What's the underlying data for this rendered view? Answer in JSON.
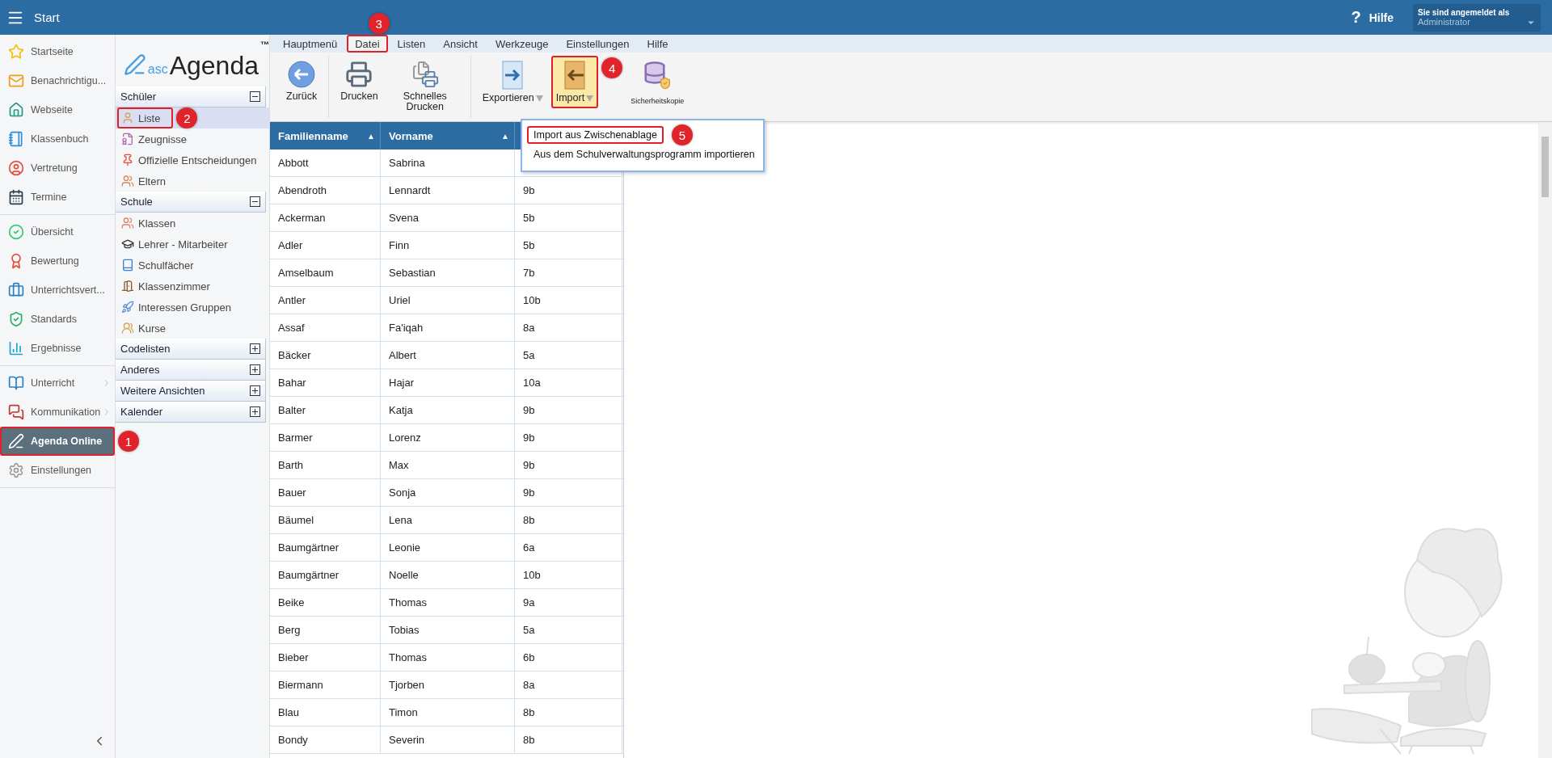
{
  "header": {
    "menu_label": "Start",
    "help_mark": "?",
    "help": "Hilfe",
    "user": {
      "caption": "Sie sind angemeldet als",
      "name": "Administrator"
    }
  },
  "nav": {
    "groups": [
      [
        {
          "label": "Startseite",
          "selected": false,
          "has_submenu": false
        },
        {
          "label": "Benachrichtigu...",
          "selected": false,
          "has_submenu": false
        },
        {
          "label": "Webseite",
          "selected": false,
          "has_submenu": false
        },
        {
          "label": "Klassenbuch",
          "selected": false,
          "has_submenu": false
        },
        {
          "label": "Vertretung",
          "selected": false,
          "has_submenu": false
        },
        {
          "label": "Termine",
          "selected": false,
          "has_submenu": false
        }
      ],
      [
        {
          "label": "Übersicht",
          "selected": false,
          "has_submenu": false
        },
        {
          "label": "Bewertung",
          "selected": false,
          "has_submenu": false
        },
        {
          "label": "Unterrichtsvert...",
          "selected": false,
          "has_submenu": false
        },
        {
          "label": "Standards",
          "selected": false,
          "has_submenu": false
        },
        {
          "label": "Ergebnisse",
          "selected": false,
          "has_submenu": false
        }
      ],
      [
        {
          "label": "Unterricht",
          "selected": false,
          "has_submenu": true
        },
        {
          "label": "Kommunikation",
          "selected": false,
          "has_submenu": true
        },
        {
          "label": "Agenda Online",
          "selected": true,
          "has_submenu": false,
          "callout": "1"
        },
        {
          "label": "Einstellungen",
          "selected": false,
          "has_submenu": false
        }
      ]
    ]
  },
  "panel": {
    "logo": {
      "prefix": "asc",
      "name": "Agenda",
      "mark": "™"
    },
    "sections": [
      {
        "title": "Schüler",
        "expanded": true,
        "items": [
          {
            "label": "Liste",
            "selected": true,
            "callout": "2"
          },
          {
            "label": "Zeugnisse",
            "selected": false
          },
          {
            "label": "Offizielle Entscheidungen",
            "selected": false
          },
          {
            "label": "Eltern",
            "selected": false
          }
        ]
      },
      {
        "title": "Schule",
        "expanded": true,
        "items": [
          {
            "label": "Klassen",
            "selected": false
          },
          {
            "label": "Lehrer - Mitarbeiter",
            "selected": false
          },
          {
            "label": "Schulfächer",
            "selected": false
          },
          {
            "label": "Klassenzimmer",
            "selected": false
          },
          {
            "label": "Interessen Gruppen",
            "selected": false
          },
          {
            "label": "Kurse",
            "selected": false
          }
        ]
      },
      {
        "title": "Codelisten",
        "expanded": false
      },
      {
        "title": "Anderes",
        "expanded": false
      },
      {
        "title": "Weitere Ansichten",
        "expanded": false
      },
      {
        "title": "Kalender",
        "expanded": false
      }
    ]
  },
  "menu_tabs": [
    {
      "label": "Hauptmenü",
      "selected": false
    },
    {
      "label": "Datei",
      "selected": true,
      "callout": "3"
    },
    {
      "label": "Listen",
      "selected": false
    },
    {
      "label": "Ansicht",
      "selected": false
    },
    {
      "label": "Werkzeuge",
      "selected": false
    },
    {
      "label": "Einstellungen",
      "selected": false
    },
    {
      "label": "Hilfe",
      "selected": false
    }
  ],
  "toolbar": [
    [
      {
        "label": "Zurück",
        "kind": "large",
        "has_dropdown": false,
        "highlighted": false
      }
    ],
    [
      {
        "label": "Drucken",
        "kind": "large",
        "has_dropdown": false,
        "highlighted": false
      },
      {
        "label": "Schnelles Drucken",
        "kind": "large",
        "has_dropdown": false,
        "highlighted": false
      }
    ],
    [
      {
        "label": "Exportieren",
        "kind": "large",
        "has_dropdown": true,
        "highlighted": false
      },
      {
        "label": "Import",
        "kind": "large",
        "has_dropdown": true,
        "highlighted": true,
        "callout": "4"
      },
      {
        "label": "Sicherheitskopie",
        "kind": "small",
        "has_dropdown": false,
        "highlighted": false
      }
    ]
  ],
  "dropdown": {
    "items": [
      {
        "label": "Import aus Zwischenablage",
        "callout": "5"
      },
      {
        "label": "Aus dem Schulverwaltungsprogramm importieren"
      }
    ]
  },
  "table": {
    "columns": [
      {
        "label": "Familienname",
        "sort_mark": "▲"
      },
      {
        "label": "Vorname",
        "sort_mark": "▲"
      }
    ],
    "rows": [
      [
        "Abbott",
        "Sabrina"
      ],
      [
        "Abendroth",
        "Lennardt",
        "9b"
      ],
      [
        "Ackerman",
        "Svena",
        "5b"
      ],
      [
        "Adler",
        "Finn",
        "5b"
      ],
      [
        "Amselbaum",
        "Sebastian",
        "7b"
      ],
      [
        "Antler",
        "Uriel",
        "10b"
      ],
      [
        "Assaf",
        "Fa'iqah",
        "8a"
      ],
      [
        "Bäcker",
        "Albert",
        "5a"
      ],
      [
        "Bahar",
        "Hajar",
        "10a"
      ],
      [
        "Balter",
        "Katja",
        "9b"
      ],
      [
        "Barmer",
        "Lorenz",
        "9b"
      ],
      [
        "Barth",
        "Max",
        "9b"
      ],
      [
        "Bauer",
        "Sonja",
        "9b"
      ],
      [
        "Bäumel",
        "Lena",
        "8b"
      ],
      [
        "Baumgärtner",
        "Leonie",
        "6a"
      ],
      [
        "Baumgärtner",
        "Noelle",
        "10b"
      ],
      [
        "Beike",
        "Thomas",
        "9a"
      ],
      [
        "Berg",
        "Tobias",
        "5a"
      ],
      [
        "Bieber",
        "Thomas",
        "6b"
      ],
      [
        "Biermann",
        "Tjorben",
        "8a"
      ],
      [
        "Blau",
        "Timon",
        "8b"
      ],
      [
        "Bondy",
        "Severin",
        "8b"
      ]
    ]
  }
}
